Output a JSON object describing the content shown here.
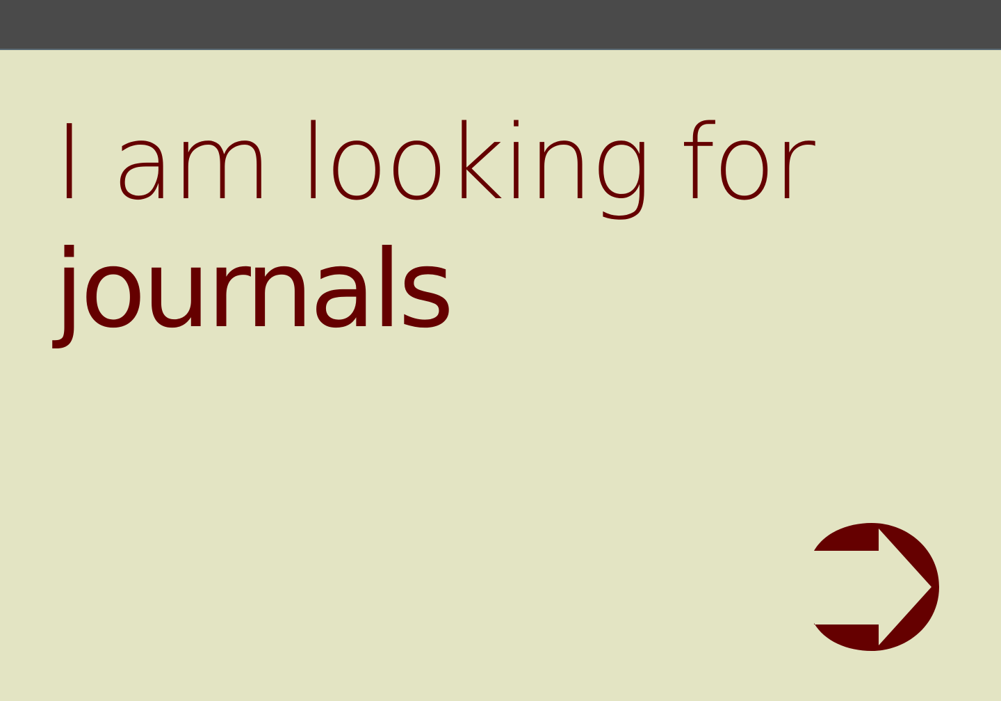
{
  "header": {
    "bar_color": "#4a4a4a"
  },
  "main": {
    "prompt_text": "I am looking for",
    "category_text": "journals"
  },
  "navigation": {
    "next_icon": "arrow-right-icon"
  },
  "colors": {
    "background": "#e3e4c3",
    "text": "#650000",
    "icon": "#650000"
  }
}
